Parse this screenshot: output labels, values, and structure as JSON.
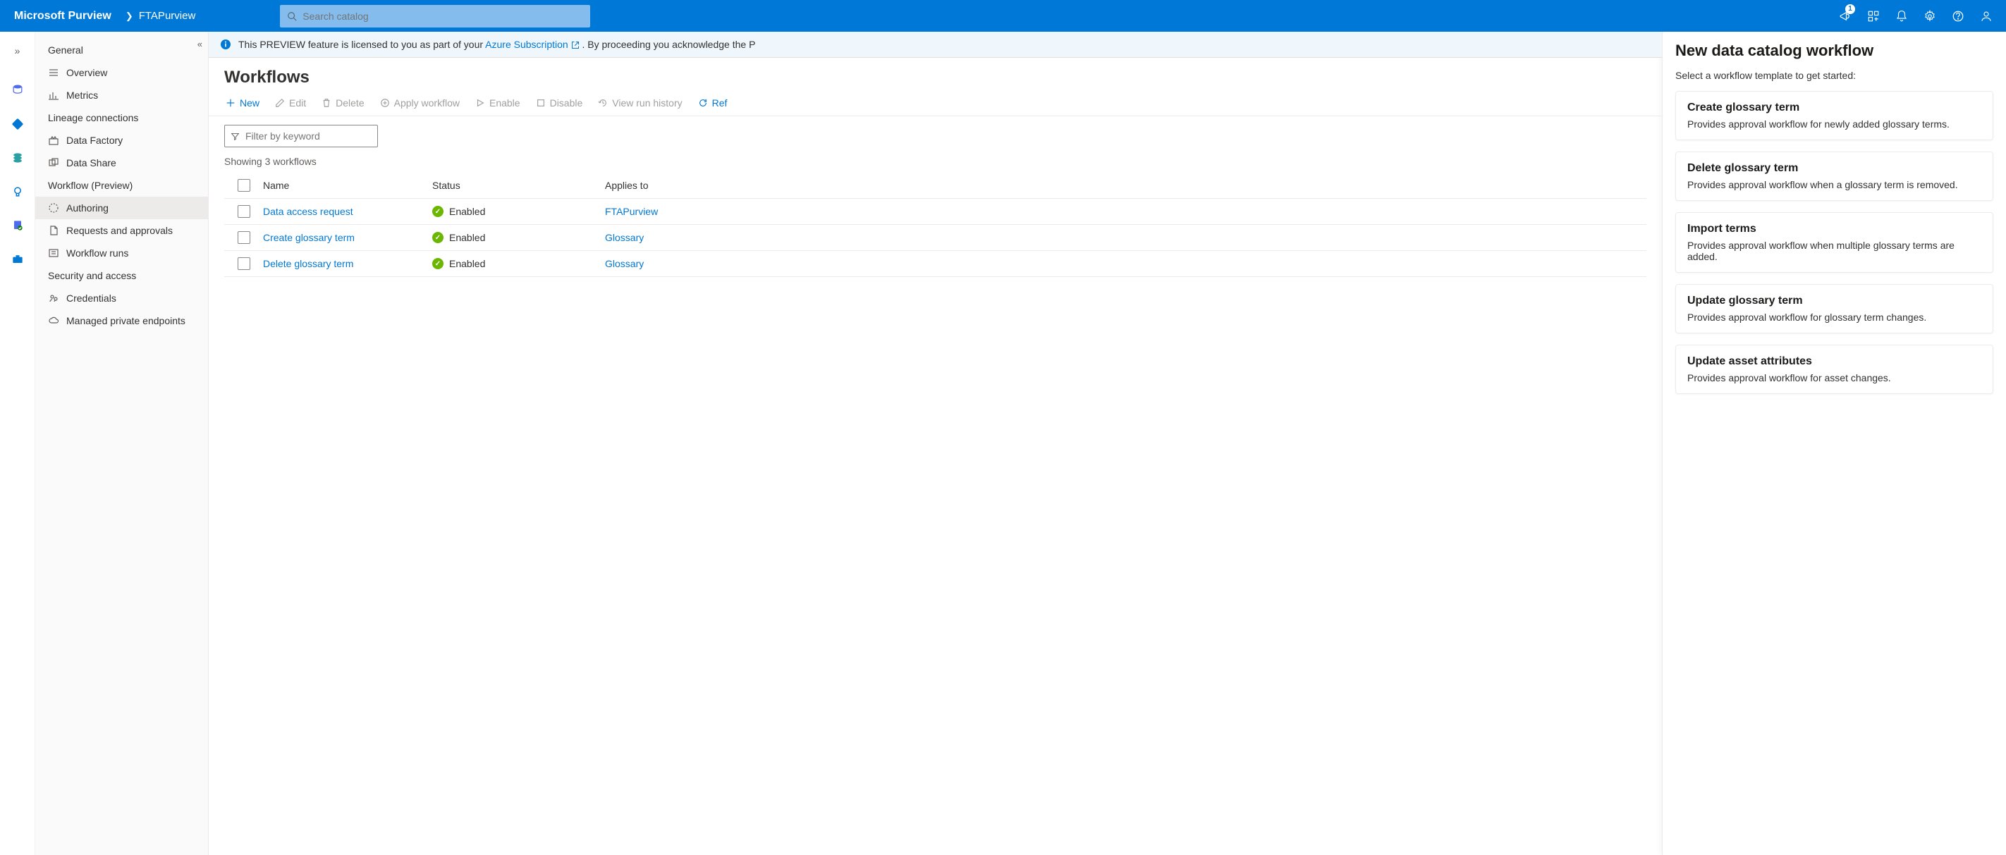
{
  "header": {
    "brand": "Microsoft Purview",
    "crumb": "FTAPurview",
    "search_placeholder": "Search catalog",
    "notification_count": "1"
  },
  "nav": {
    "sections": {
      "general": "General",
      "lineage": "Lineage connections",
      "workflow": "Workflow (Preview)",
      "security": "Security and access"
    },
    "items": {
      "overview": "Overview",
      "metrics": "Metrics",
      "datafactory": "Data Factory",
      "datashare": "Data Share",
      "authoring": "Authoring",
      "requests": "Requests and approvals",
      "runs": "Workflow runs",
      "credentials": "Credentials",
      "endpoints": "Managed private endpoints"
    }
  },
  "banner": {
    "prefix": "This PREVIEW feature is licensed to you as part of your ",
    "link": "Azure Subscription",
    "suffix": ". By proceeding you acknowledge the P"
  },
  "page": {
    "title": "Workflows",
    "toolbar": {
      "new": "New",
      "edit": "Edit",
      "delete": "Delete",
      "apply": "Apply workflow",
      "enable": "Enable",
      "disable": "Disable",
      "history": "View run history",
      "refresh": "Ref"
    },
    "filter_placeholder": "Filter by keyword",
    "count": "Showing 3 workflows",
    "columns": {
      "name": "Name",
      "status": "Status",
      "applies": "Applies to"
    },
    "rows": [
      {
        "name": "Data access request",
        "status": "Enabled",
        "applies": "FTAPurview"
      },
      {
        "name": "Create glossary term",
        "status": "Enabled",
        "applies": "Glossary"
      },
      {
        "name": "Delete glossary term",
        "status": "Enabled",
        "applies": "Glossary"
      }
    ]
  },
  "panel": {
    "title": "New data catalog workflow",
    "subtitle": "Select a workflow template to get started:",
    "templates": [
      {
        "title": "Create glossary term",
        "desc": "Provides approval workflow for newly added glossary terms."
      },
      {
        "title": "Delete glossary term",
        "desc": "Provides approval workflow when a glossary term is removed."
      },
      {
        "title": "Import terms",
        "desc": "Provides approval workflow when multiple glossary terms are added."
      },
      {
        "title": "Update glossary term",
        "desc": "Provides approval workflow for glossary term changes."
      },
      {
        "title": "Update asset attributes",
        "desc": "Provides approval workflow for asset changes."
      }
    ]
  }
}
